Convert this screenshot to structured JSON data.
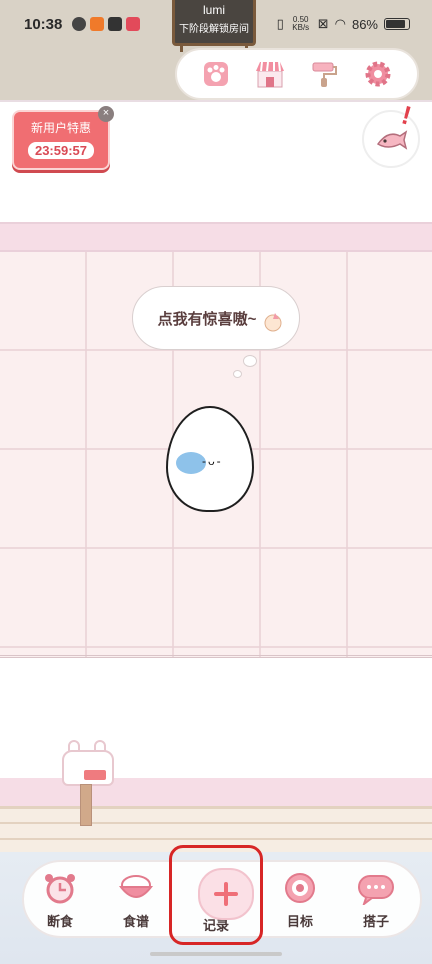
{
  "status_bar": {
    "time": "10:38",
    "speed_value": "0.50",
    "speed_unit": "KB/s",
    "battery": "86%",
    "battery_level": 0.86
  },
  "sign": {
    "name": "lumi",
    "subtitle": "下阶段解锁房间"
  },
  "toolbar": {
    "icons": [
      "paw-icon",
      "shop-icon",
      "paint-roller-icon",
      "gear-icon"
    ]
  },
  "promo": {
    "title": "新用户特惠",
    "countdown": "23:59:57"
  },
  "speech": "点我有惊喜嗷~",
  "nav": {
    "items": [
      {
        "label": "断食",
        "icon": "alarm-clock-icon"
      },
      {
        "label": "食谱",
        "icon": "rice-bowl-icon"
      },
      {
        "label": "记录",
        "icon": "plus-icon"
      },
      {
        "label": "目标",
        "icon": "target-icon"
      },
      {
        "label": "搭子",
        "icon": "chat-bubble-icon"
      }
    ]
  },
  "colors": {
    "accent": "#ef6f78",
    "promo_red": "#f06e72",
    "highlight_red": "#d72626"
  }
}
